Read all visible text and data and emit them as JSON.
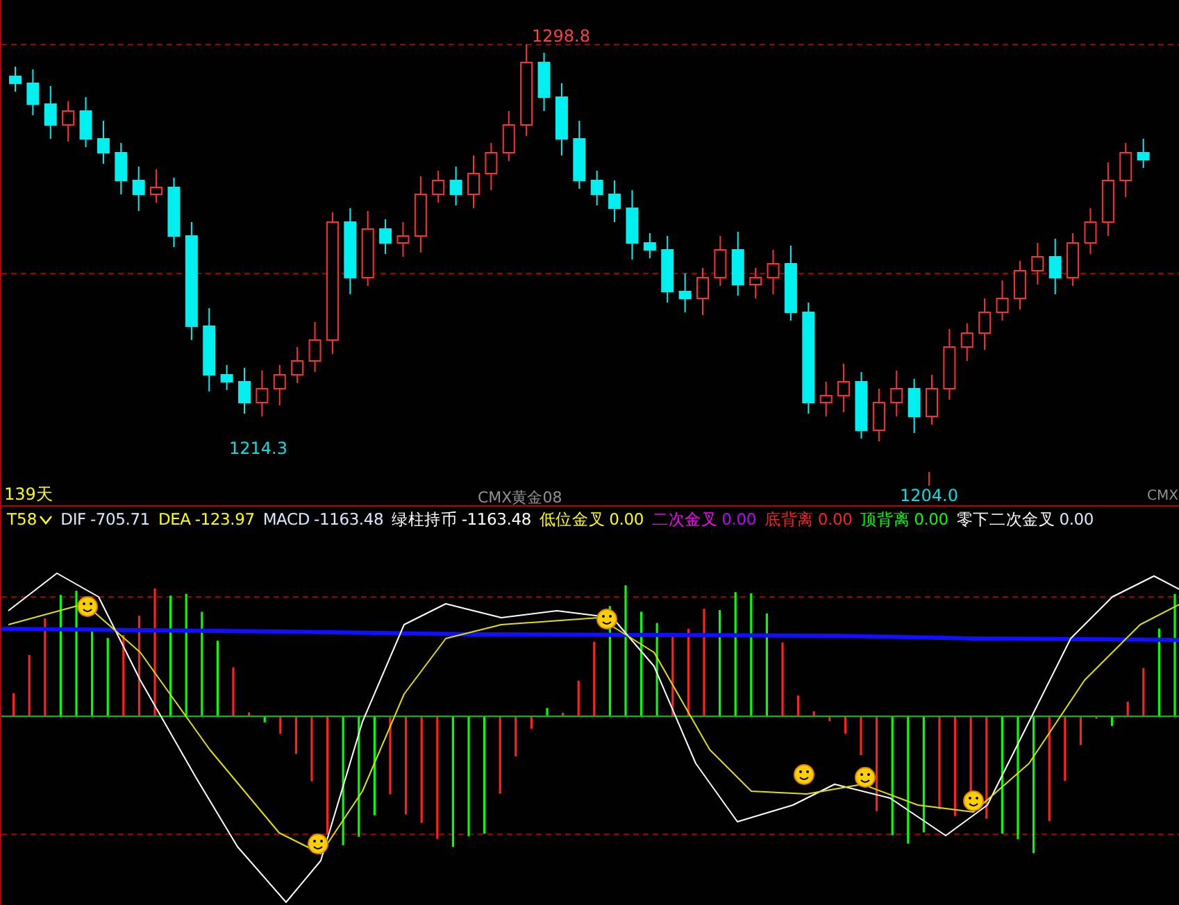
{
  "price_chart": {
    "high_label": "1298.8",
    "low_labels": [
      "1214.3",
      "1204.0"
    ],
    "period": "139天",
    "symbol_labels": [
      "CMX黄金08",
      "CMX"
    ]
  },
  "indicator_bar": {
    "name": "T58",
    "items": [
      {
        "label": {
          "text": "DIF",
          "color": "#d8e8ff"
        },
        "value": {
          "text": "-705.71",
          "color": "#d8e8ff"
        }
      },
      {
        "label": {
          "text": "DEA",
          "color": "#ffff00"
        },
        "value": {
          "text": "-123.97",
          "color": "#ffff00"
        }
      },
      {
        "label": {
          "text": "MACD",
          "color": "#d8e8ff"
        },
        "value": {
          "text": "-1163.48",
          "color": "#d8e8ff"
        }
      },
      {
        "label": {
          "text": "绿柱持币",
          "color": "#ffffff"
        },
        "value": {
          "text": "-1163.48",
          "color": "#ffffff"
        }
      },
      {
        "label": {
          "text": "低位金叉",
          "color": "#ffff00"
        },
        "value": {
          "text": "0.00",
          "color": "#ffff00"
        }
      },
      {
        "label": {
          "text": "二次金叉",
          "color": "#ff00ff"
        },
        "value": {
          "text": "0.00",
          "color": "#c000ff"
        }
      },
      {
        "label": {
          "text": "底背离",
          "color": "#ff2020"
        },
        "value": {
          "text": "0.00",
          "color": "#ff2020"
        }
      },
      {
        "label": {
          "text": "顶背离",
          "color": "#00ff00"
        },
        "value": {
          "text": "0.00",
          "color": "#00ff00"
        }
      },
      {
        "label": {
          "text": "零下二次金叉",
          "color": "#ffffff"
        },
        "value": {
          "text": "0.00",
          "color": "#d8e8ff"
        }
      }
    ]
  }
}
